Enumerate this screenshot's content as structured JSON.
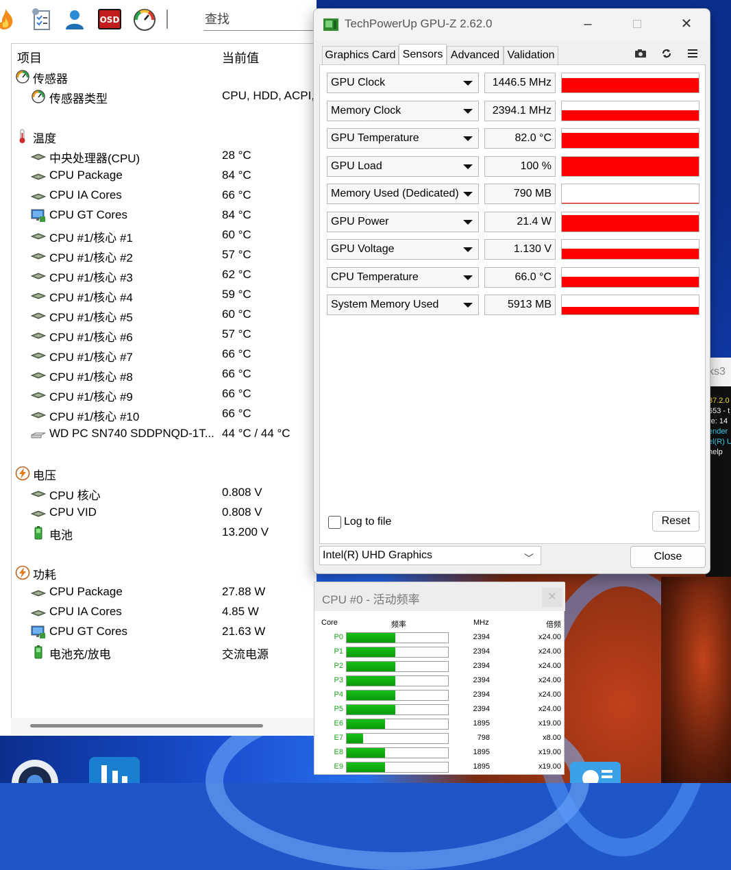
{
  "aida": {
    "search_placeholder": "查找",
    "col_item": "项目",
    "col_value": "当前值",
    "rows": [
      {
        "label": "传感器",
        "value": "",
        "icon": "gauge-icon",
        "indent": 0
      },
      {
        "label": "传感器类型",
        "value": "CPU, HDD, ACPI,",
        "icon": "gauge-icon",
        "indent": 1
      },
      {
        "label": "温度",
        "value": "",
        "icon": "thermometer-icon",
        "indent": 0
      },
      {
        "label": "中央处理器(CPU)",
        "value": "28 °C",
        "icon": "cpu-chip-icon",
        "indent": 1
      },
      {
        "label": "CPU Package",
        "value": "84 °C",
        "icon": "cpu-chip-icon",
        "indent": 1
      },
      {
        "label": "CPU IA Cores",
        "value": "66 °C",
        "icon": "cpu-chip-icon",
        "indent": 1
      },
      {
        "label": "CPU GT Cores",
        "value": "84 °C",
        "icon": "monitor-icon",
        "indent": 1
      },
      {
        "label": "CPU #1/核心 #1",
        "value": "60 °C",
        "icon": "cpu-chip-icon",
        "indent": 1
      },
      {
        "label": "CPU #1/核心 #2",
        "value": "57 °C",
        "icon": "cpu-chip-icon",
        "indent": 1
      },
      {
        "label": "CPU #1/核心 #3",
        "value": "62 °C",
        "icon": "cpu-chip-icon",
        "indent": 1
      },
      {
        "label": "CPU #1/核心 #4",
        "value": "59 °C",
        "icon": "cpu-chip-icon",
        "indent": 1
      },
      {
        "label": "CPU #1/核心 #5",
        "value": "60 °C",
        "icon": "cpu-chip-icon",
        "indent": 1
      },
      {
        "label": "CPU #1/核心 #6",
        "value": "57 °C",
        "icon": "cpu-chip-icon",
        "indent": 1
      },
      {
        "label": "CPU #1/核心 #7",
        "value": "66 °C",
        "icon": "cpu-chip-icon",
        "indent": 1
      },
      {
        "label": "CPU #1/核心 #8",
        "value": "66 °C",
        "icon": "cpu-chip-icon",
        "indent": 1
      },
      {
        "label": "CPU #1/核心 #9",
        "value": "66 °C",
        "icon": "cpu-chip-icon",
        "indent": 1
      },
      {
        "label": "CPU #1/核心 #10",
        "value": "66 °C",
        "icon": "cpu-chip-icon",
        "indent": 1
      },
      {
        "label": "WD PC SN740 SDDPNQD-1T...",
        "value": "44 °C / 44 °C",
        "icon": "drive-icon",
        "indent": 1
      },
      {
        "label": "电压",
        "value": "",
        "icon": "bolt-icon",
        "indent": 0
      },
      {
        "label": "CPU 核心",
        "value": "0.808 V",
        "icon": "cpu-chip-icon",
        "indent": 1
      },
      {
        "label": "CPU VID",
        "value": "0.808 V",
        "icon": "cpu-chip-icon",
        "indent": 1
      },
      {
        "label": "电池",
        "value": "13.200 V",
        "icon": "battery-icon",
        "indent": 1
      },
      {
        "label": "功耗",
        "value": "",
        "icon": "bolt-icon",
        "indent": 0
      },
      {
        "label": "CPU Package",
        "value": "27.88 W",
        "icon": "cpu-chip-icon",
        "indent": 1
      },
      {
        "label": "CPU IA Cores",
        "value": "4.85 W",
        "icon": "cpu-chip-icon",
        "indent": 1
      },
      {
        "label": "CPU GT Cores",
        "value": "21.63 W",
        "icon": "monitor-icon",
        "indent": 1
      },
      {
        "label": "电池充/放电",
        "value": "交流电源",
        "icon": "battery-icon",
        "indent": 1
      }
    ]
  },
  "gpuz": {
    "title": "TechPowerUp GPU-Z 2.62.0",
    "tabs": [
      "Graphics Card",
      "Sensors",
      "Advanced",
      "Validation"
    ],
    "active_tab": "Sensors",
    "sensors": [
      {
        "name": "GPU Clock",
        "value": "1446.5 MHz",
        "fill": 0.75
      },
      {
        "name": "Memory Clock",
        "value": "2394.1 MHz",
        "fill": 0.55
      },
      {
        "name": "GPU Temperature",
        "value": "82.0 °C",
        "fill": 0.8
      },
      {
        "name": "GPU Load",
        "value": "100 %",
        "fill": 1.0
      },
      {
        "name": "Memory Used (Dedicated)",
        "value": "790 MB",
        "fill": 0.05
      },
      {
        "name": "GPU Power",
        "value": "21.4 W",
        "fill": 0.85
      },
      {
        "name": "GPU Voltage",
        "value": "1.130 V",
        "fill": 0.55
      },
      {
        "name": "CPU Temperature",
        "value": "66.0 °C",
        "fill": 0.55
      },
      {
        "name": "System Memory Used",
        "value": "5913 MB",
        "fill": 0.4
      }
    ],
    "log_label": "Log to file",
    "reset_label": "Reset",
    "close_label": "Close",
    "gpu_name": "Intel(R) UHD Graphics"
  },
  "cpufreq": {
    "title": "CPU #0 - 活动频率",
    "col_core": "Core",
    "col_freq": "频率",
    "col_mhz": "MHz",
    "col_mult": "倍频",
    "cores": [
      {
        "core": "P0",
        "mhz": "2394",
        "mult": "x24.00",
        "fill": 0.48
      },
      {
        "core": "P1",
        "mhz": "2394",
        "mult": "x24.00",
        "fill": 0.48
      },
      {
        "core": "P2",
        "mhz": "2394",
        "mult": "x24.00",
        "fill": 0.48
      },
      {
        "core": "P3",
        "mhz": "2394",
        "mult": "x24.00",
        "fill": 0.48
      },
      {
        "core": "P4",
        "mhz": "2394",
        "mult": "x24.00",
        "fill": 0.48
      },
      {
        "core": "P5",
        "mhz": "2394",
        "mult": "x24.00",
        "fill": 0.48
      },
      {
        "core": "E6",
        "mhz": "1895",
        "mult": "x19.00",
        "fill": 0.38
      },
      {
        "core": "E7",
        "mhz": "798",
        "mult": "x8.00",
        "fill": 0.16
      },
      {
        "core": "E8",
        "mhz": "1895",
        "mult": "x19.00",
        "fill": 0.38
      },
      {
        "core": "E9",
        "mhz": "1895",
        "mult": "x19.00",
        "fill": 0.38
      }
    ]
  },
  "side_window": {
    "title_fragment": "ks3",
    "lines": [
      "37.2.0",
      "653 - t",
      "re: 14",
      "ender",
      "el(R) U",
      "help"
    ],
    "line_colors": [
      "#f5e12a",
      "#ffffff",
      "#ffffff",
      "#3ad1f0",
      "#3ad1f0",
      "#ffffff"
    ]
  },
  "toolbar_icons": [
    "flame-icon",
    "checklist-icon",
    "user-icon",
    "osd-icon",
    "speedometer-icon"
  ]
}
